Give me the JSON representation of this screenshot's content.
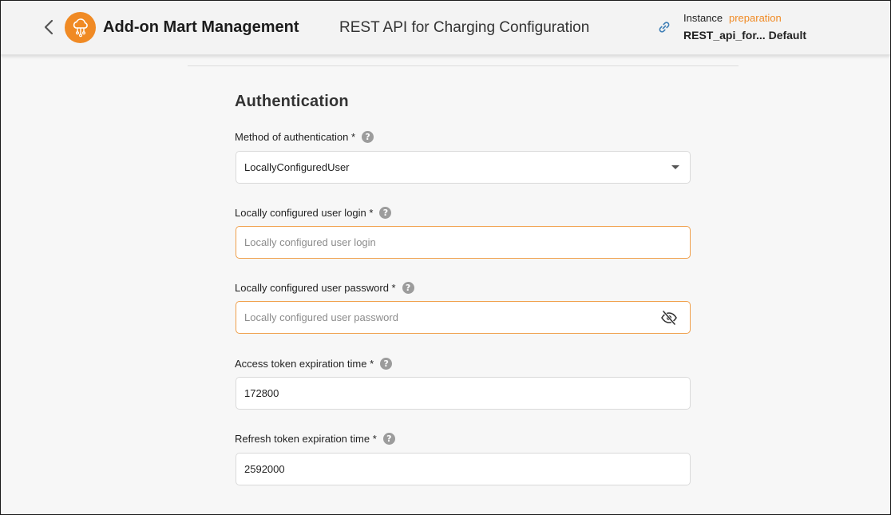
{
  "header": {
    "app_title": "Add-on Mart Management",
    "page_subtitle": "REST API for Charging Configuration",
    "instance_label": "Instance",
    "instance_status": "preparation",
    "instance_name": "REST_api_for... Default",
    "icons": {
      "back": "chevron-left-icon",
      "logo": "cloud-network-icon",
      "link": "link-icon"
    },
    "colors": {
      "accent": "#f08a24"
    }
  },
  "section": {
    "title": "Authentication"
  },
  "fields": {
    "method": {
      "label": "Method of authentication *",
      "value": "LocallyConfiguredUser"
    },
    "login": {
      "label": "Locally configured user login *",
      "placeholder": "Locally configured user login",
      "value": ""
    },
    "password": {
      "label": "Locally configured user password *",
      "placeholder": "Locally configured user password",
      "value": "",
      "toggle_icon": "eye-off-icon"
    },
    "access_token": {
      "label": "Access token expiration time *",
      "value": "172800"
    },
    "refresh_token": {
      "label": "Refresh token expiration time *",
      "value": "2592000"
    }
  },
  "help_glyph": "?"
}
